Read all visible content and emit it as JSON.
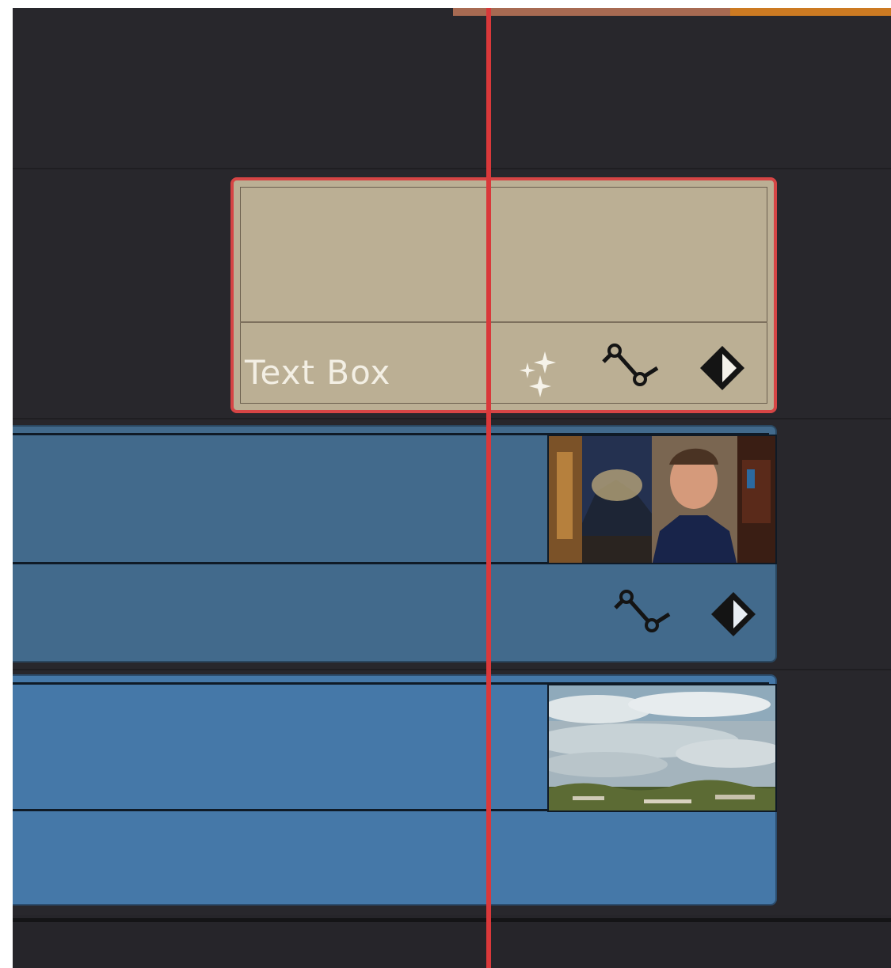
{
  "timeline": {
    "title_clip": {
      "label": "Text Box",
      "selected": true
    },
    "clip_icons": {
      "effects": "sparkle-fx-icon",
      "curve": "curve-keyframe-icon",
      "keyframe": "keyframe-diamond-icon"
    },
    "video_clip_2": {
      "thumbnail": "man-portrait-thumbnail"
    },
    "video_clip_1": {
      "thumbnail": "sky-landscape-thumbnail"
    },
    "colors": {
      "background": "#28272c",
      "title_clip": "#bbaf94",
      "title_clip_selected_border": "#d64545",
      "video_clip_upper": "#426a8c",
      "video_clip_lower": "#4578a8",
      "playhead": "#d9383a"
    }
  }
}
